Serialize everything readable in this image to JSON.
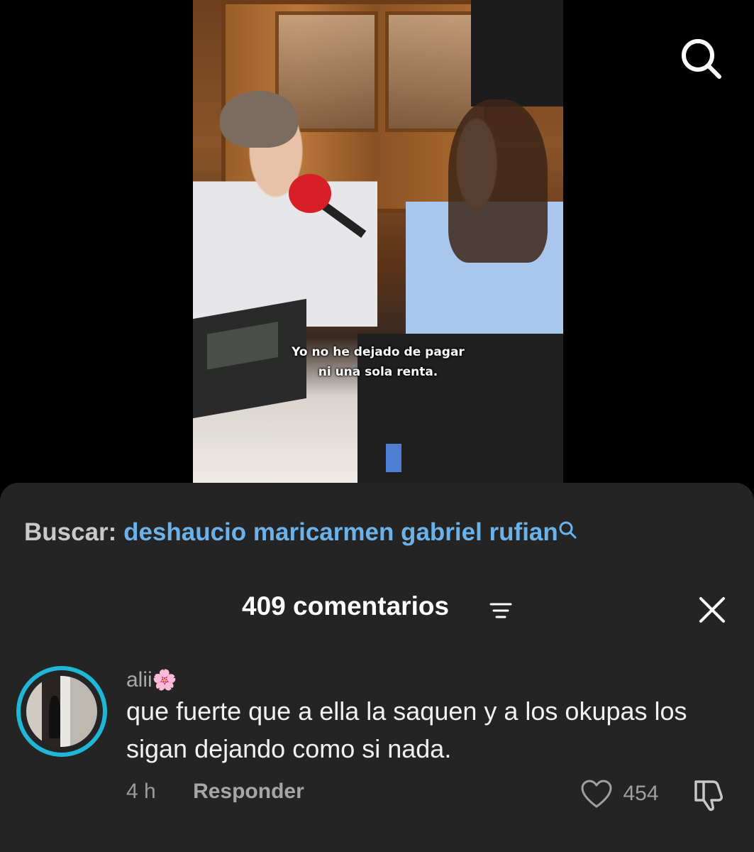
{
  "video": {
    "subtitle_line1": "Yo no he dejado de pagar",
    "subtitle_line2": "ni una sola renta."
  },
  "top_bar": {
    "search_icon": "search-icon"
  },
  "search_suggestion": {
    "label": "Buscar:",
    "term": "deshaucio maricarmen gabriel rufian",
    "icon": "search-icon"
  },
  "comments_header": {
    "count_label": "409 comentarios",
    "sort_icon": "sort-lines-icon",
    "close_icon": "close-icon"
  },
  "comments": [
    {
      "username": "alii",
      "username_emoji": "🌸",
      "text": "que fuerte que a ella la saquen y a los okupas los sigan dejando como si nada.",
      "time": "4 h",
      "reply_label": "Responder",
      "likes": "454",
      "avatar_ring_color": "#20b6d6"
    }
  ],
  "colors": {
    "sheet_bg": "#242424",
    "link_blue": "#6cb2ea"
  }
}
